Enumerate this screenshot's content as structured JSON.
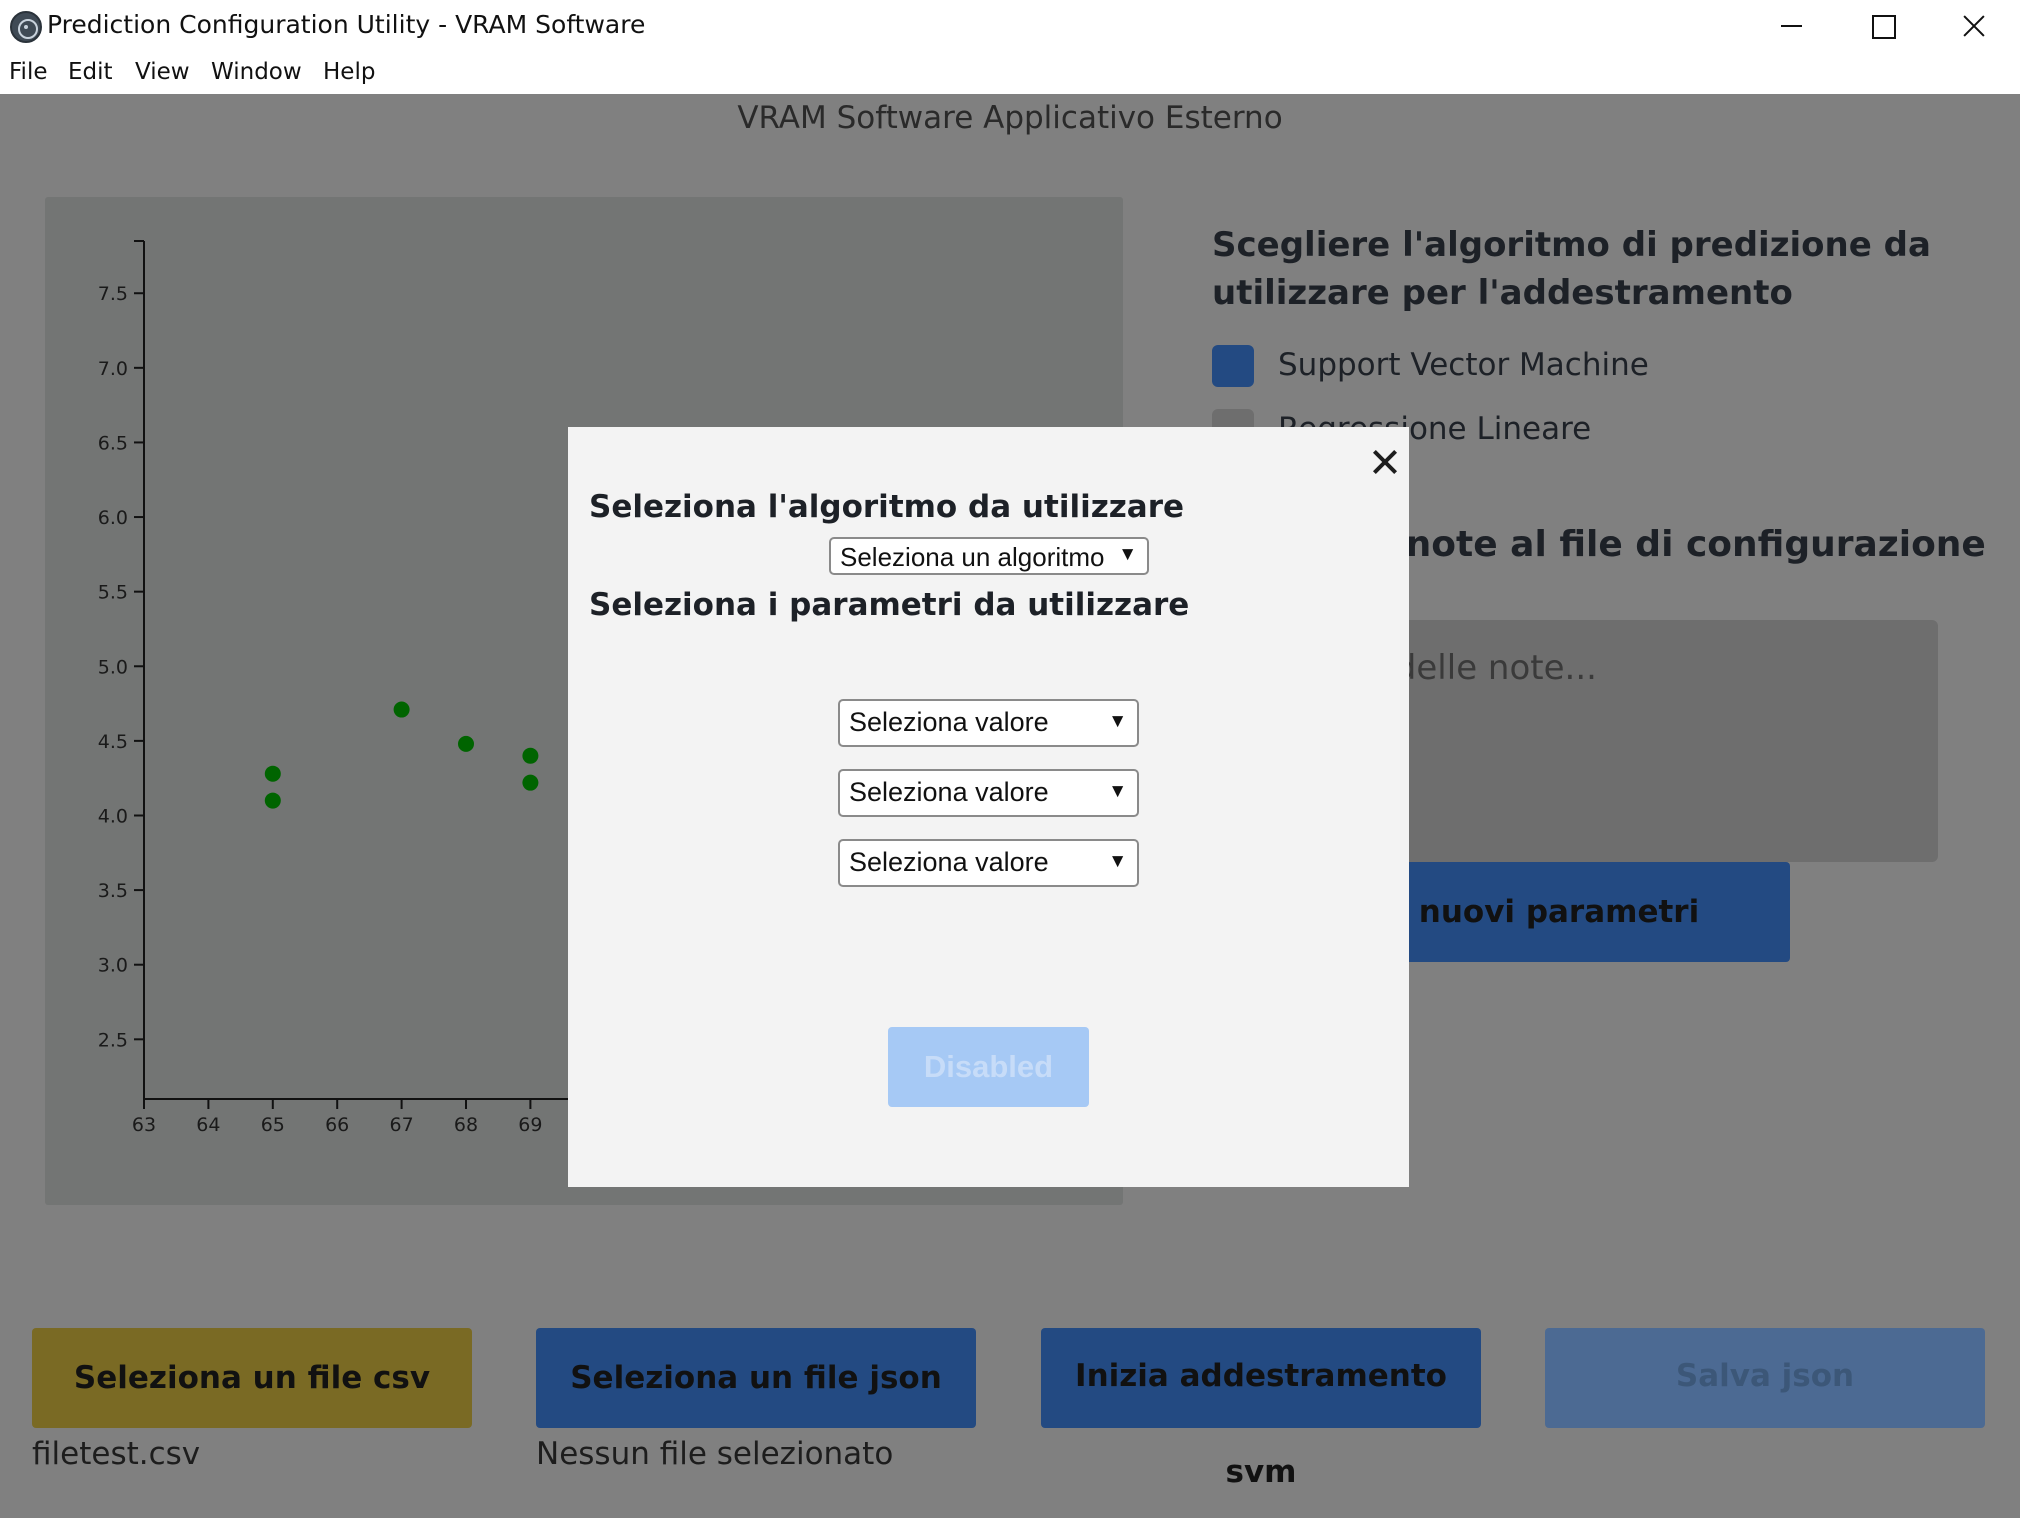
{
  "window": {
    "title": "Prediction Configuration Utility - VRAM Software"
  },
  "menu": [
    "File",
    "Edit",
    "View",
    "Window",
    "Help"
  ],
  "app": {
    "header": "VRAM Software Applicativo Esterno"
  },
  "chart_data": {
    "type": "scatter",
    "title": "",
    "xlabel": "",
    "ylabel": "",
    "x_ticks": [
      63,
      64,
      65,
      66,
      67,
      68,
      69
    ],
    "y_ticks": [
      2.5,
      3.0,
      3.5,
      4.0,
      4.5,
      5.0,
      5.5,
      6.0,
      6.5,
      7.0,
      7.5
    ],
    "y_tick_labels": [
      "2.5",
      "3.0",
      "3.5",
      "4.0",
      "4.5",
      "5.0",
      "5.5",
      "6.0",
      "6.5",
      "7.0",
      "7.5"
    ],
    "xlim": [
      63,
      77
    ],
    "ylim": [
      2.1,
      7.85
    ],
    "point_color": "#006400",
    "points": [
      {
        "x": 65,
        "y": 4.28
      },
      {
        "x": 65,
        "y": 4.1
      },
      {
        "x": 67,
        "y": 4.71
      },
      {
        "x": 68,
        "y": 4.48
      },
      {
        "x": 69,
        "y": 4.4
      },
      {
        "x": 69,
        "y": 4.22
      }
    ]
  },
  "right_panel": {
    "title": "Scegliere l'algoritmo di predizione da utilizzare per l'addestramento",
    "algorithms": [
      {
        "label": "Support Vector Machine",
        "selected": true,
        "color": "#234a82"
      },
      {
        "label": "Regressione Lineare",
        "selected": false,
        "color": "#6e6e6e"
      }
    ],
    "notes_title": "Aggiungi note al file di configurazione",
    "notes_placeholder": "Aggiungi delle note...",
    "new_params_button": "Scegli nuovi parametri"
  },
  "bottom_buttons": {
    "csv": {
      "label": "Seleziona un file csv",
      "color": "#7a6a24",
      "caption": "filetest.csv"
    },
    "json": {
      "label": "Seleziona un file json",
      "color": "#234a82",
      "caption": "Nessun file selezionato"
    },
    "train": {
      "label": "Inizia addestramento svm",
      "color": "#234a82"
    },
    "save": {
      "label": "Salva json",
      "color": "#4c6a93"
    }
  },
  "modal": {
    "algorithm_heading": "Seleziona l'algoritmo da utilizzare",
    "algorithm_select": "Seleziona un algoritmo",
    "params_heading": "Seleziona i parametri da utilizzare",
    "param_selects": [
      "Seleziona valore",
      "Seleziona valore",
      "Seleziona valore"
    ],
    "submit_button": "Disabled"
  }
}
